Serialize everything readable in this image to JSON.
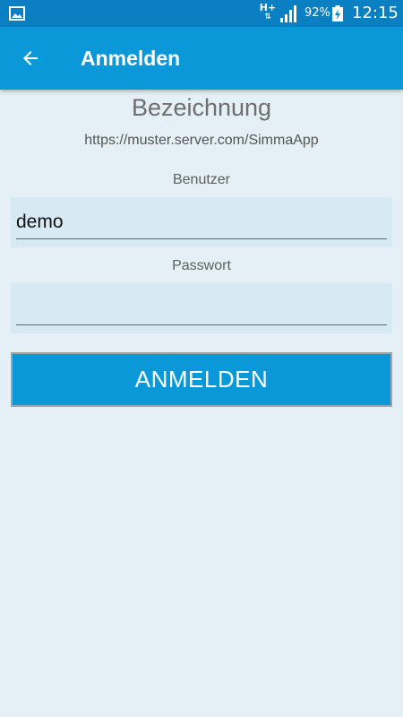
{
  "status_bar": {
    "network": "H+",
    "network_arrows": "⇅",
    "battery_percent": "92%",
    "time": "12:15",
    "icons": [
      "gallery-icon",
      "signal-icon",
      "battery-charging-icon"
    ]
  },
  "app_bar": {
    "title": "Anmelden",
    "back_icon": "arrow-left-icon"
  },
  "login": {
    "site_title": "Bezeichnung",
    "site_url": "https://muster.server.com/SimmaApp",
    "username_label": "Benutzer",
    "username_value": "demo",
    "password_label": "Passwort",
    "password_value": "",
    "submit_label": "ANMELDEN"
  },
  "colors": {
    "status_bar": "#0a7fc2",
    "app_bar": "#0a98d8",
    "background": "#e4eff6",
    "field_background": "#d7e9f3",
    "button": "#0a98d8"
  }
}
